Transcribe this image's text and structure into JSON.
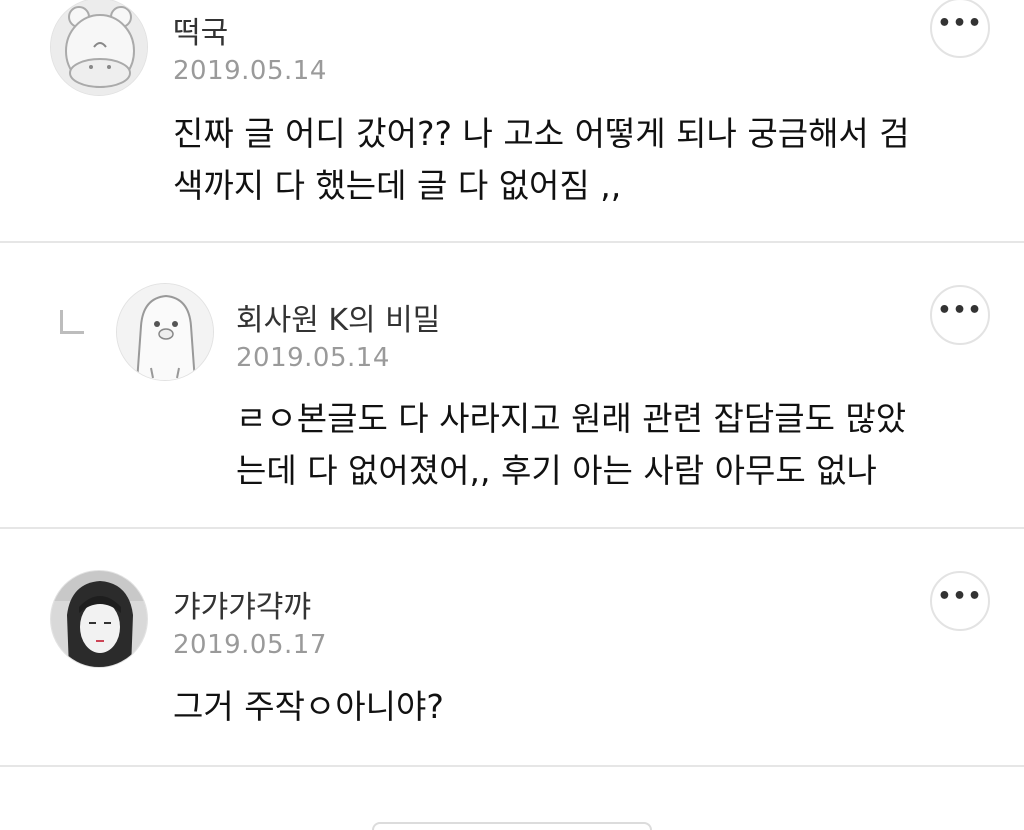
{
  "comments": [
    {
      "author": "떡국",
      "date": "2019.05.14",
      "lines": [
        "진짜 글 어디 갔어?? 나 고소 어떻게 되나 궁금해서 검",
        "색까지 다 했는데 글 다 없어짐 ,,"
      ],
      "avatar_icon": "hamster-avatar-icon"
    },
    {
      "author": "회사원 K의 비밀",
      "date": "2019.05.14",
      "lines": [
        "ㄹㅇ본글도 다 사라지고 원래 관련 잡담글도 많았",
        "는데 다 없어졌어,, 후기 아는 사람 아무도 없나"
      ],
      "avatar_icon": "penguin-avatar-icon",
      "is_reply": true
    },
    {
      "author": "갸갸갸갹꺄",
      "date": "2019.05.17",
      "lines": [
        "그거 주작ㅇ아니야?"
      ],
      "avatar_icon": "manga-girl-avatar-icon"
    }
  ],
  "more_icon": "more-options-icon",
  "reply_icon": "reply-indent-icon"
}
